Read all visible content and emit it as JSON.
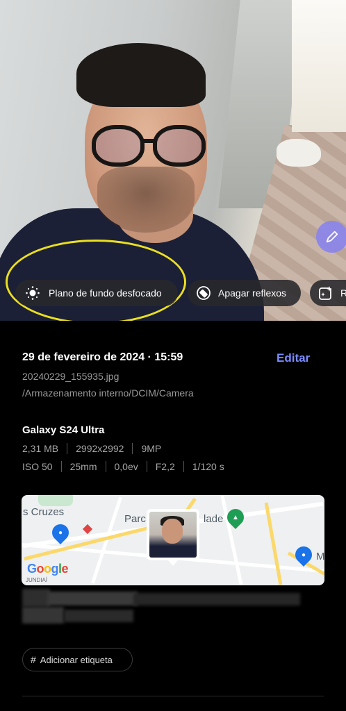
{
  "photo": {
    "chips": [
      {
        "label": "Plano de fundo desfocado",
        "icon": "background-blur-icon"
      },
      {
        "label": "Apagar reflexos",
        "icon": "eraser-icon"
      },
      {
        "label": "R",
        "icon": "sparkle-frame-icon"
      }
    ],
    "ai_button_icon": "pen-icon"
  },
  "details": {
    "datetime": "29 de fevereiro de 2024 · 15:59",
    "edit_label": "Editar",
    "filename": "20240229_155935.jpg",
    "path": "/Armazenamento interno/DCIM/Camera"
  },
  "camera": {
    "device": "Galaxy S24 Ultra",
    "row1": [
      "2,31 MB",
      "2992x2992",
      "9MP"
    ],
    "row2": [
      "ISO 50",
      "25mm",
      "0,0ev",
      "F2,2",
      "1/120 s"
    ]
  },
  "map": {
    "labels": [
      "s Cruzes",
      "Parc",
      "lade",
      "M",
      "JUNDIAÍ"
    ],
    "attribution": "Google"
  },
  "tag": {
    "label": "Adicionar etiqueta"
  },
  "colors": {
    "accent": "#7b8cff",
    "highlight": "#ecdf1f",
    "ai_button": "#8c86e9"
  }
}
